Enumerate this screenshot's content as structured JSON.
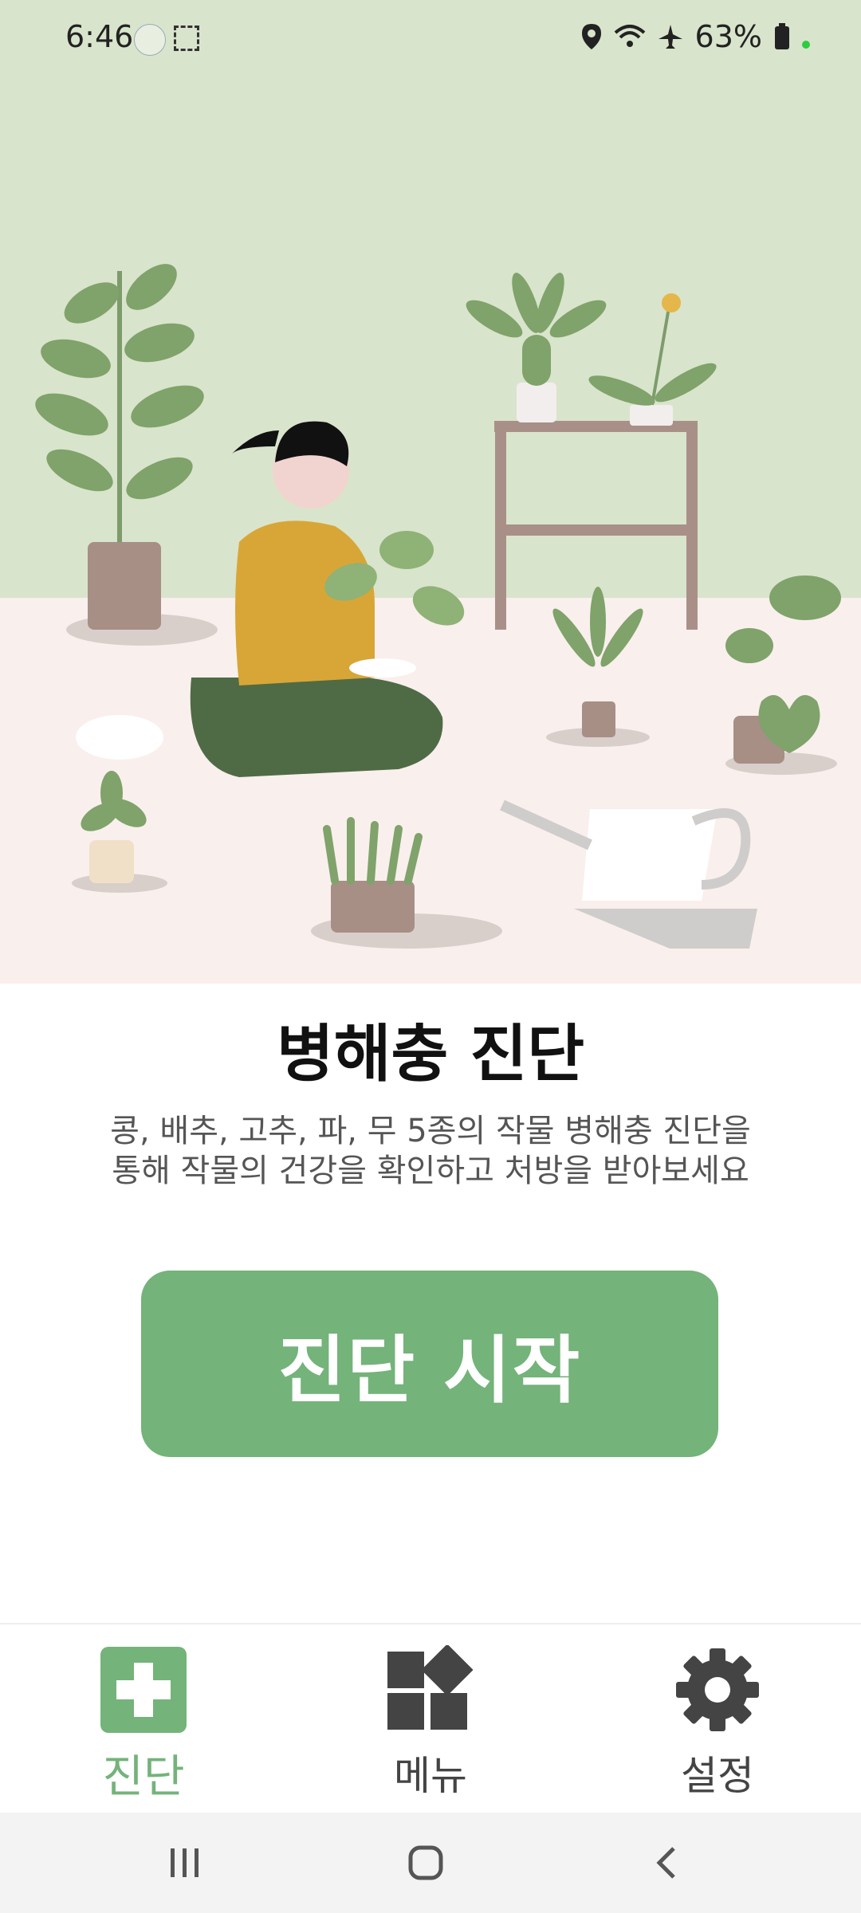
{
  "status_bar": {
    "time": "6:46",
    "battery": "63%",
    "icons": [
      "app-notification-icon",
      "screenshot-icon",
      "location-icon",
      "wifi-icon",
      "airplane-icon",
      "battery-icon"
    ]
  },
  "hero": {
    "description_icon": "gardening-illustration"
  },
  "main": {
    "title": "병해충 진단",
    "description_line1": "콩, 배추, 고추, 파, 무 5종의 작물 병해충 진단을",
    "description_line2": "통해 작물의 건강을 확인하고 처방을 받아보세요",
    "start_button": "진단 시작"
  },
  "bottom_nav": {
    "items": [
      {
        "label": "진단",
        "icon": "plus-icon",
        "active": true
      },
      {
        "label": "메뉴",
        "icon": "menu-grid-icon",
        "active": false
      },
      {
        "label": "설정",
        "icon": "gear-icon",
        "active": false
      }
    ]
  },
  "colors": {
    "accent": "#74b37a",
    "wall": "#d9e4cc",
    "floor": "#f9efed"
  }
}
